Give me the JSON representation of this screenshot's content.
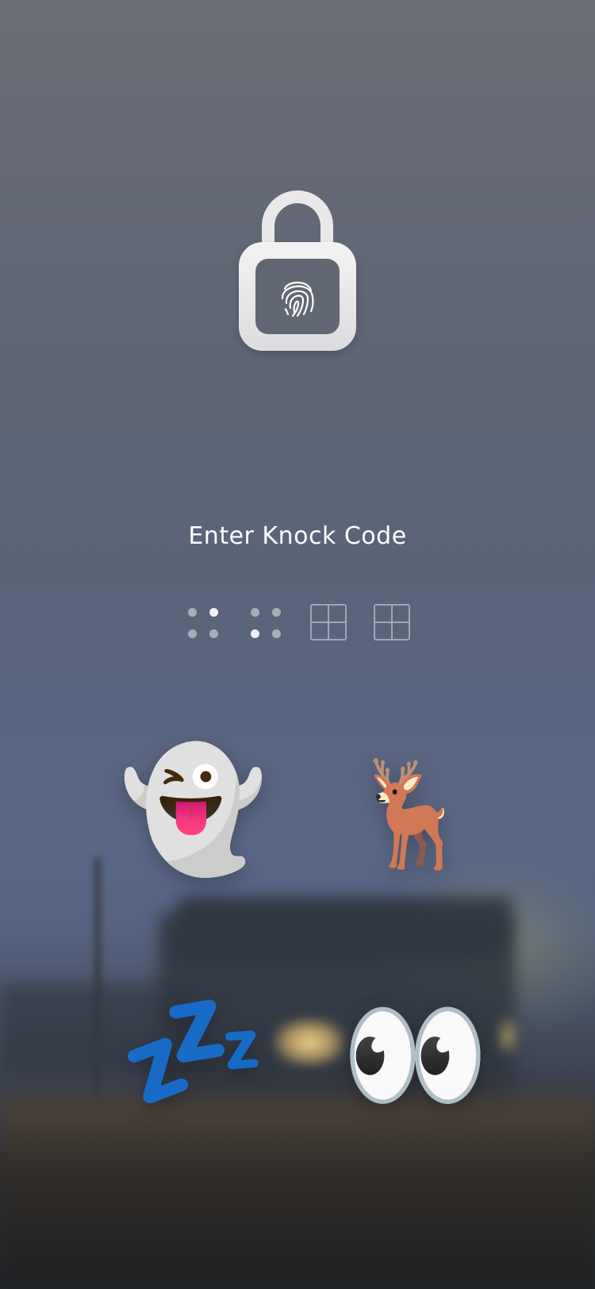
{
  "lock_screen": {
    "prompt": "Enter Knock Code",
    "lock_icon": "unlocked-padlock-fingerprint-icon",
    "knock_code_entries": [
      {
        "icon": "knock-dots-icon",
        "active_dots": [
          1
        ]
      },
      {
        "icon": "knock-dots-icon",
        "active_dots": [
          2
        ]
      },
      {
        "icon": "knock-grid-icon"
      },
      {
        "icon": "knock-grid-icon"
      }
    ],
    "emoji": {
      "ghost": "👻",
      "deer": "🦌",
      "zzz": "💤",
      "eyes": "👀"
    }
  }
}
